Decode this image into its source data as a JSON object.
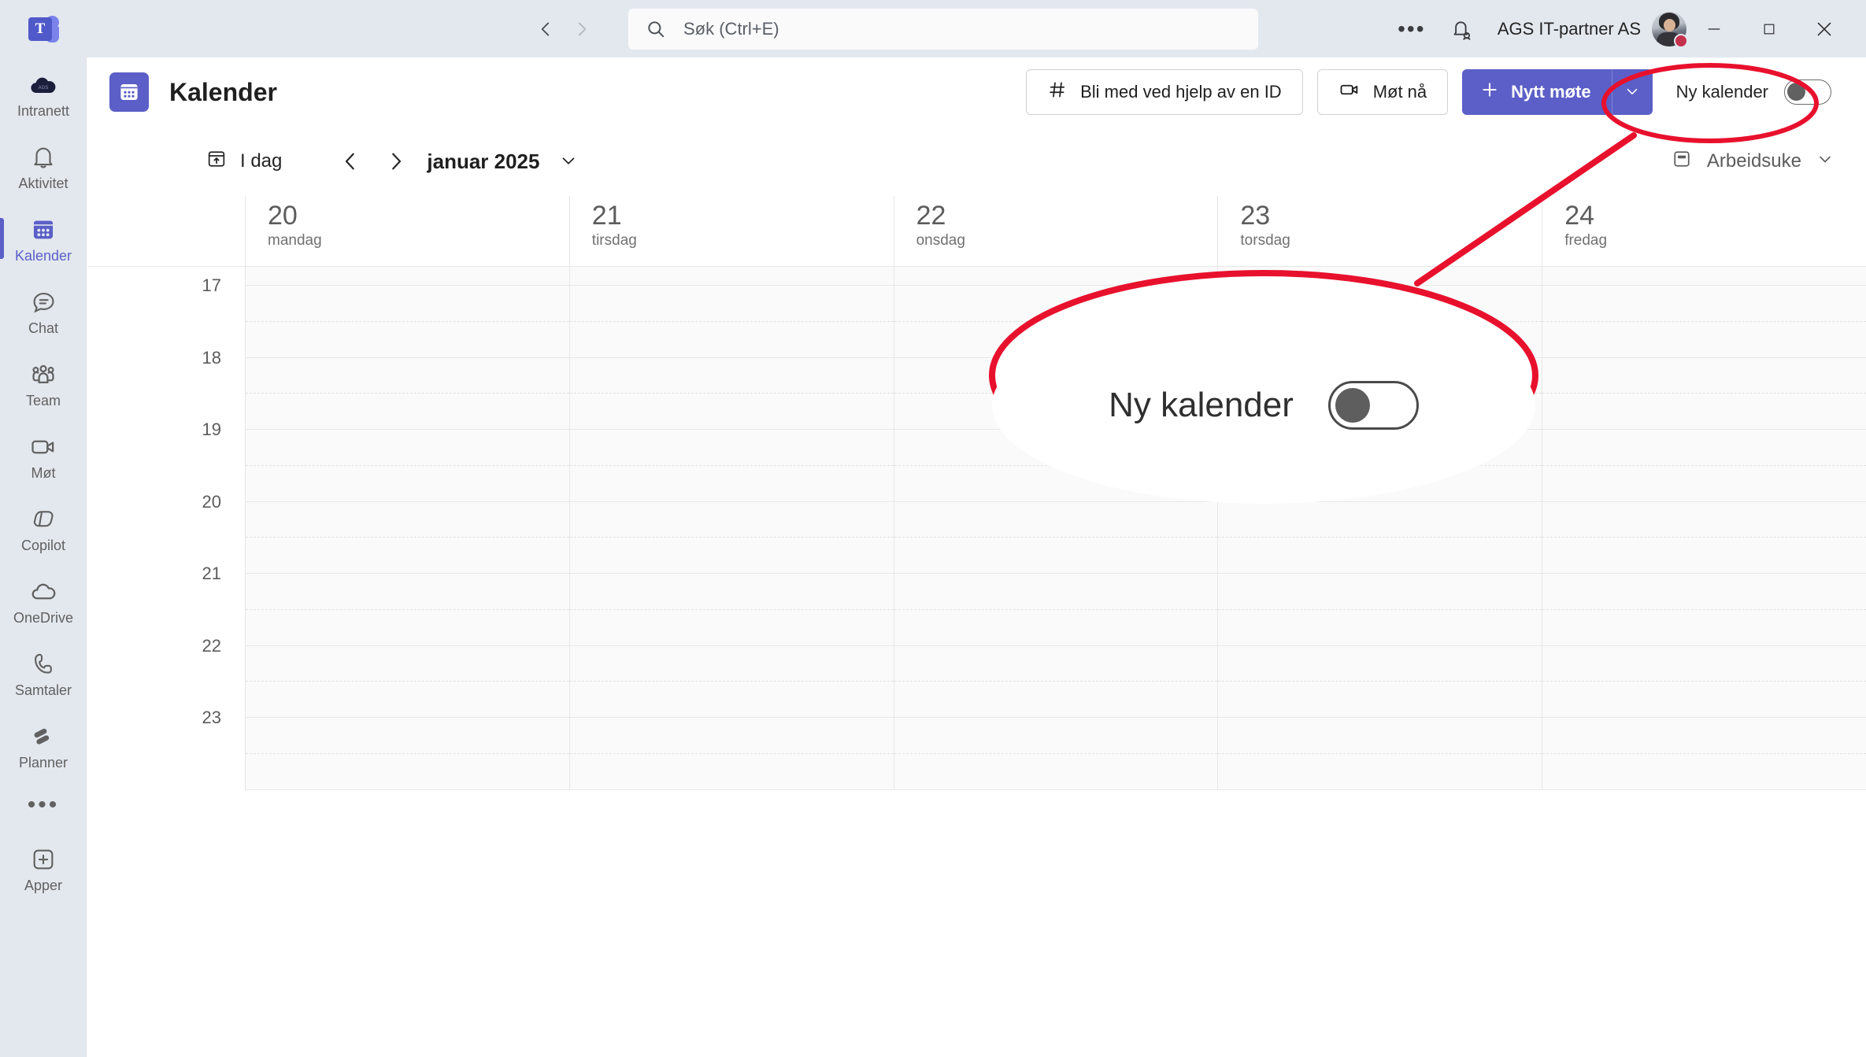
{
  "titlebar": {
    "nav_back_icon": "chevron-left-icon",
    "nav_forward_icon": "chevron-right-icon",
    "search": {
      "placeholder": "Søk (Ctrl+E)",
      "value": "",
      "icon": "search-icon"
    },
    "more_icon": "ellipsis-icon",
    "notifications_icon": "bell-person-icon",
    "account_name": "AGS IT-partner AS",
    "avatar_icon": "avatar",
    "presence_status_color": "#c4314b",
    "minimize_icon": "minimize-icon",
    "maximize_icon": "maximize-icon",
    "close_icon": "close-icon",
    "logo_text": "T"
  },
  "rail": {
    "items": [
      {
        "label": "Intranett",
        "icon": "cloud-ags-icon",
        "active": false
      },
      {
        "label": "Aktivitet",
        "icon": "bell-icon",
        "active": false
      },
      {
        "label": "Kalender",
        "icon": "calendar-icon",
        "active": true
      },
      {
        "label": "Chat",
        "icon": "chat-bubble-icon",
        "active": false
      },
      {
        "label": "Team",
        "icon": "people-team-icon",
        "active": false
      },
      {
        "label": "Møt",
        "icon": "video-camera-icon",
        "active": false
      },
      {
        "label": "Copilot",
        "icon": "copilot-icon",
        "active": false
      },
      {
        "label": "OneDrive",
        "icon": "cloud-icon",
        "active": false
      },
      {
        "label": "Samtaler",
        "icon": "phone-icon",
        "active": false
      },
      {
        "label": "Planner",
        "icon": "planner-icon",
        "active": false
      },
      {
        "label": "",
        "icon": "ellipsis-icon",
        "active": false
      },
      {
        "label": "Apper",
        "icon": "plus-box-icon",
        "active": false
      }
    ]
  },
  "header": {
    "app_icon": "calendar-app-icon",
    "title": "Kalender",
    "join_with_id_label": "Bli med ved hjelp av en ID",
    "join_with_id_icon": "hash-icon",
    "meet_now_label": "Møt nå",
    "meet_now_icon": "video-camera-icon",
    "new_meeting_label": "Nytt møte",
    "new_meeting_icon": "plus-icon",
    "new_meeting_caret_icon": "chevron-down-icon",
    "new_calendar_label": "Ny kalender",
    "new_calendar_toggle_state": "off",
    "accent_color": "#5b5fc7"
  },
  "date_nav": {
    "today_label": "I dag",
    "today_icon": "today-calendar-icon",
    "prev_icon": "chevron-left-icon",
    "next_icon": "chevron-right-icon",
    "month_label": "januar 2025",
    "month_caret_icon": "chevron-down-icon",
    "view_label": "Arbeidsuke",
    "view_icon": "workweek-icon",
    "view_caret_icon": "chevron-down-icon"
  },
  "calendar": {
    "days": [
      {
        "num": "20",
        "name": "mandag"
      },
      {
        "num": "21",
        "name": "tirsdag"
      },
      {
        "num": "22",
        "name": "onsdag"
      },
      {
        "num": "23",
        "name": "torsdag"
      },
      {
        "num": "24",
        "name": "fredag"
      }
    ],
    "hours": [
      "17",
      "18",
      "19",
      "20",
      "21",
      "22",
      "23"
    ],
    "events": []
  },
  "annotation": {
    "color": "#e8112d",
    "zoom_label": "Ny kalender",
    "zoom_toggle_state": "off"
  }
}
